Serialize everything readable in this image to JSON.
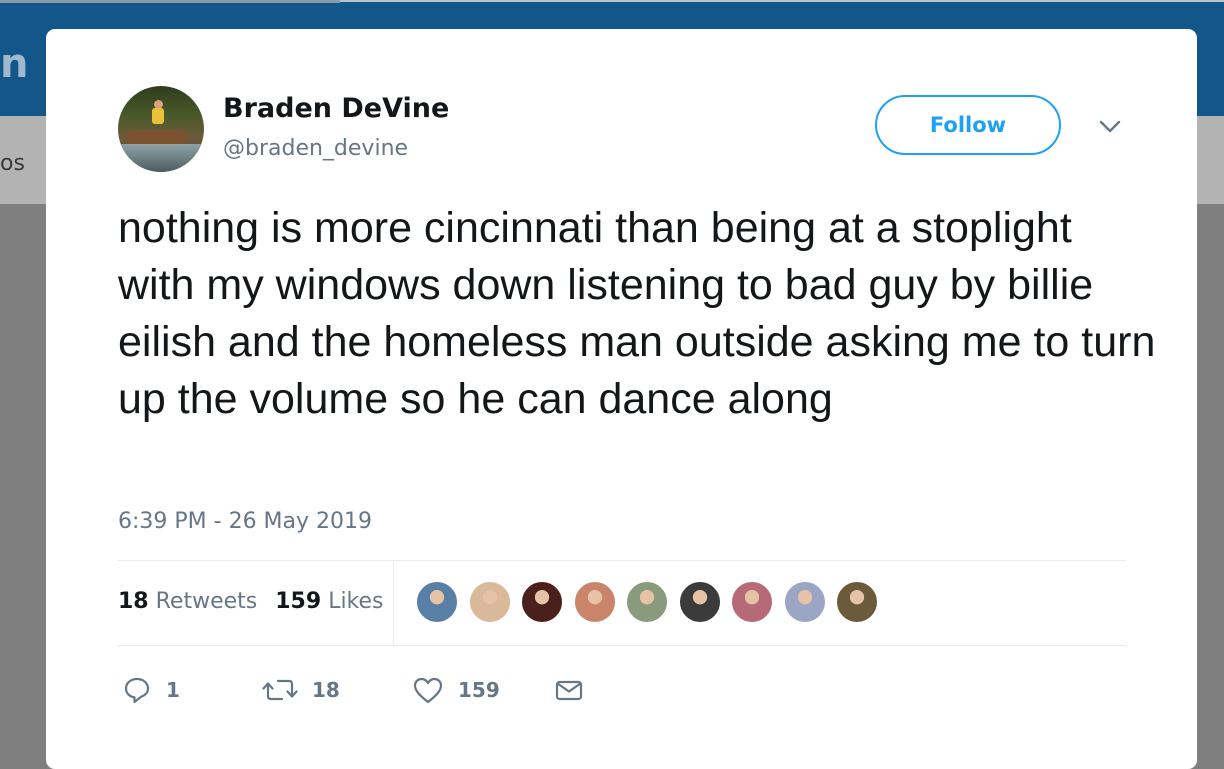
{
  "background": {
    "logo_fragment": "n",
    "nav_fragment": "os",
    "header_color": "#13578a"
  },
  "tweet": {
    "author": {
      "name": "Braden DeVine",
      "handle": "@braden_devine"
    },
    "follow_label": "Follow",
    "text": "nothing is more cincinnati than being at a stoplight with my windows down listening to bad guy by billie eilish and the homeless man outside asking me to turn up the volume so he can dance along",
    "timestamp": "6:39 PM - 26 May 2019",
    "stats": {
      "retweets_count": "18",
      "retweets_label": "Retweets",
      "likes_count": "159",
      "likes_label": "Likes"
    },
    "liker_avatars": [
      {
        "icon": "avatar",
        "color": "#5a7fa6"
      },
      {
        "icon": "avatar",
        "color": "#d9b99a"
      },
      {
        "icon": "avatar",
        "color": "#4a1f1c"
      },
      {
        "icon": "avatar",
        "color": "#c9846a"
      },
      {
        "icon": "avatar",
        "color": "#8a9a7c"
      },
      {
        "icon": "avatar",
        "color": "#3b3b3b"
      },
      {
        "icon": "avatar",
        "color": "#b66a78"
      },
      {
        "icon": "avatar",
        "color": "#9aa6c4"
      },
      {
        "icon": "avatar",
        "color": "#6b5a3c"
      }
    ],
    "actions": {
      "reply_count": "1",
      "retweet_count": "18",
      "like_count": "159"
    },
    "accent_color": "#1da1f2"
  }
}
